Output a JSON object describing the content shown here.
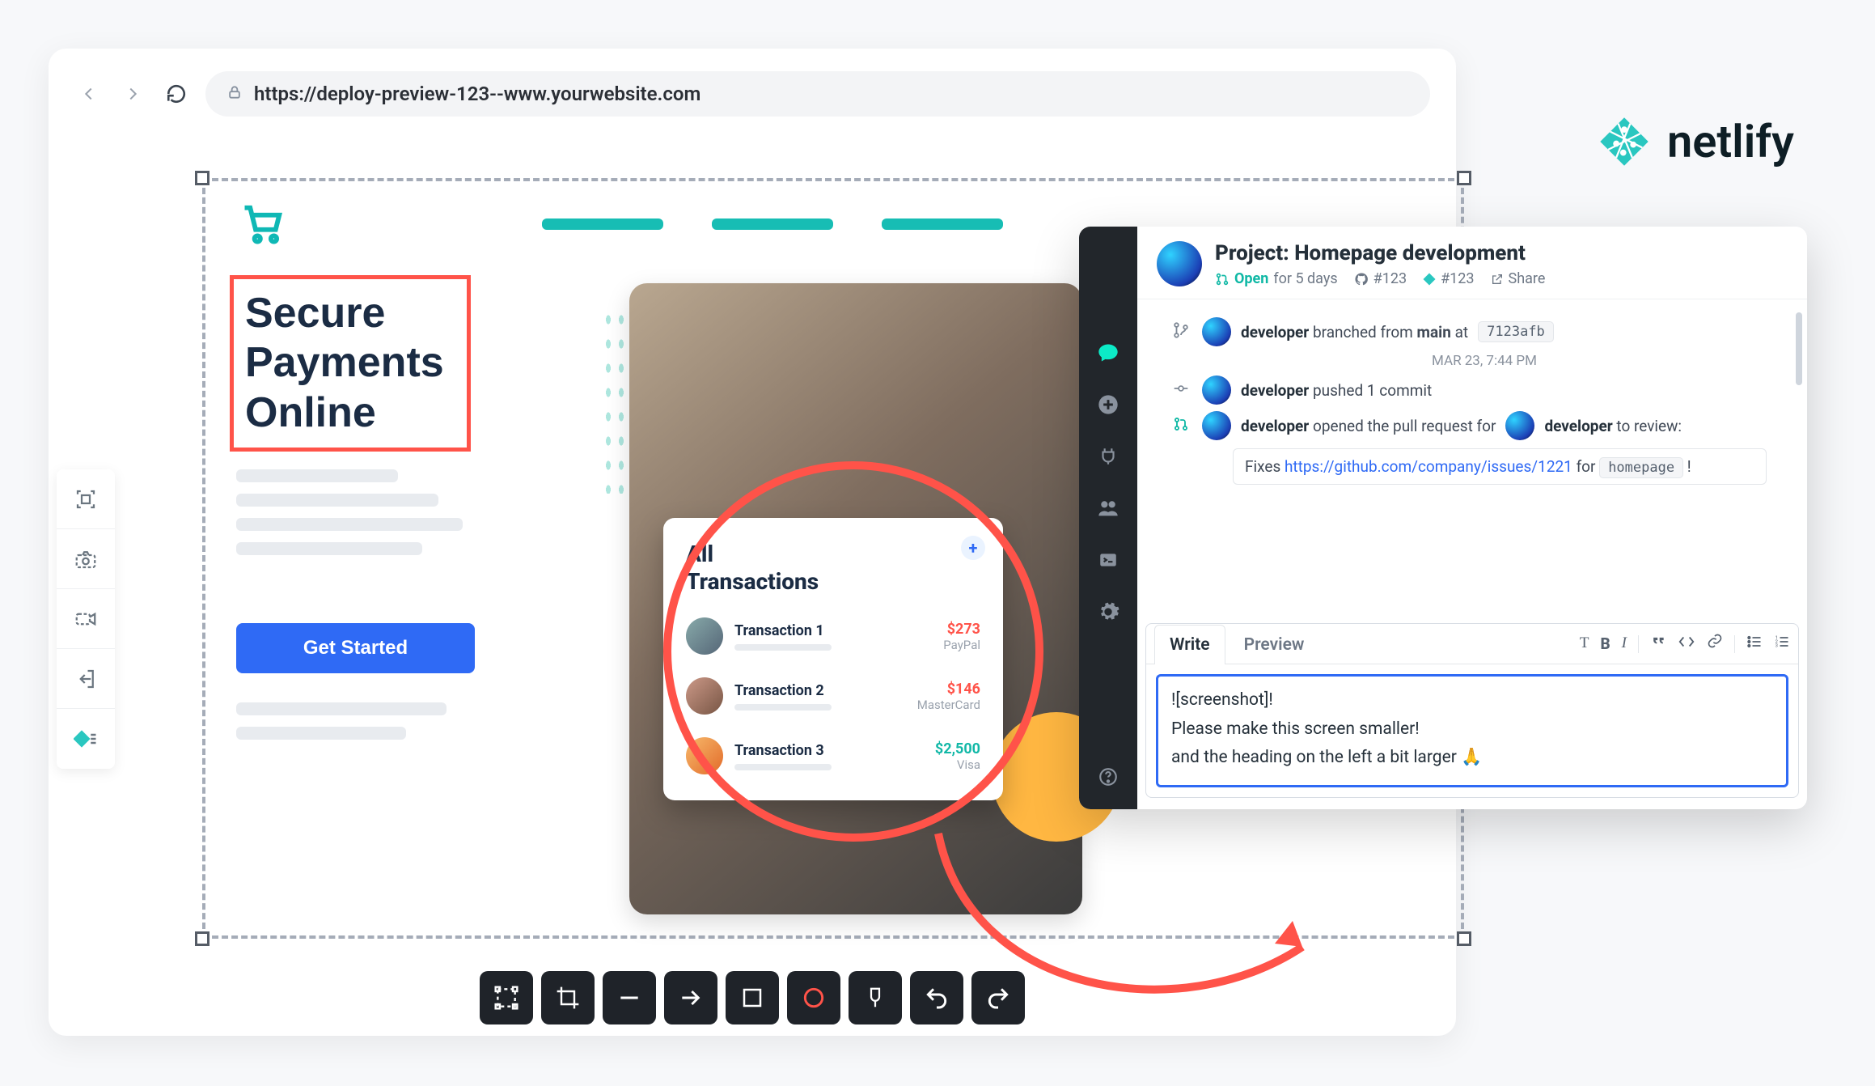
{
  "brand": "netlify",
  "url": "https://deploy-preview-123--www.yourwebsite.com",
  "headline": "Secure\nPayments\nOnline",
  "cta": "Get Started",
  "transactions": {
    "title": "All\nTransactions",
    "rows": [
      {
        "name": "Transaction 1",
        "amount": "$273",
        "source": "PayPal",
        "amtClass": "red"
      },
      {
        "name": "Transaction 2",
        "amount": "$146",
        "source": "MasterCard",
        "amtClass": "red"
      },
      {
        "name": "Transaction 3",
        "amount": "$2,500",
        "source": "Visa",
        "amtClass": "teal"
      }
    ]
  },
  "collab": {
    "title": "Project: Homepage development",
    "status": "Open",
    "status_for": "for 5 days",
    "gh_ref": "#123",
    "nl_ref": "#123",
    "share": "Share",
    "timestamp": "MAR 23, 7:44 PM",
    "branch_msg_before": "branched from",
    "branch_name": "main",
    "branch_msg_after": "at",
    "commit_sha": "7123afb",
    "push_msg": "pushed 1 commit",
    "pr_msg_before": "opened the pull request for",
    "pr_msg_after": "to review:",
    "developer": "developer",
    "fixes_prefix": "Fixes",
    "fixes_link": "https://github.com/company/issues/1221",
    "fixes_mid": "for",
    "fixes_chip": "homepage",
    "fixes_bang": "!",
    "tabs": {
      "write": "Write",
      "preview": "Preview"
    },
    "comment_l1": "![screenshot]!",
    "comment_l2": "Please make this screen smaller!",
    "comment_l3": "and the heading on the left a bit larger 🙏"
  }
}
